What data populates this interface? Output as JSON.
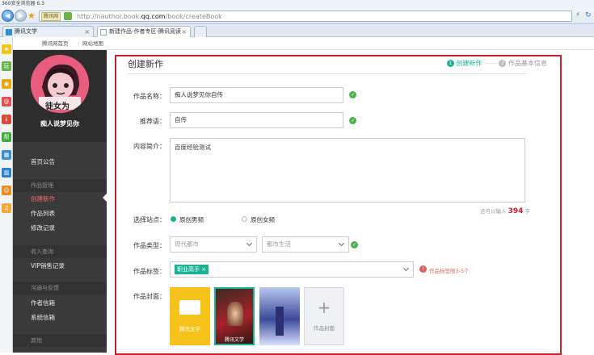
{
  "browser": {
    "title": "360安全浏览器 6.3",
    "url_prefix": "http://nauthor.book.",
    "url_domain": "qq.com",
    "url_path": "/book/createBook",
    "url_tag": "腾讯网",
    "tabs": [
      {
        "label": "腾讯文学"
      },
      {
        "label": "新建作品-作者专区-腾讯阅读"
      }
    ]
  },
  "site_links": [
    "腾讯网首页",
    "网站地图"
  ],
  "sidebar": {
    "username": "痴人说梦见你",
    "avatar_text": "徒女为",
    "nav": [
      {
        "type": "item",
        "label": "首页公告"
      },
      {
        "type": "head",
        "label": "作品管理"
      },
      {
        "type": "item",
        "label": "创建新作",
        "active": true
      },
      {
        "type": "item",
        "label": "作品列表"
      },
      {
        "type": "item",
        "label": "修改记录"
      },
      {
        "type": "head",
        "label": "收入查询"
      },
      {
        "type": "item",
        "label": "VIP销售记录"
      },
      {
        "type": "head",
        "label": "沟通与反馈"
      },
      {
        "type": "item",
        "label": "作者信箱"
      },
      {
        "type": "item",
        "label": "系统信箱"
      },
      {
        "type": "head",
        "label": "其他"
      }
    ]
  },
  "page": {
    "title": "创建新作",
    "step1_num": "1",
    "step1": "创建新作",
    "step2_num": "2",
    "step2": "作品基本信息"
  },
  "form": {
    "name_label": "作品名称：",
    "name_value": "痴人说梦见你自传",
    "slogan_label": "推荐语：",
    "slogan_value": "自传",
    "intro_label": "内容简介：",
    "intro_value": "百度经验测试",
    "intro_count_prefix": "还可以输入",
    "intro_count": "394",
    "intro_count_suffix": "字",
    "site_label": "选择站点：",
    "site_options": [
      "原创男频",
      "原创女频"
    ],
    "type_label": "作品类型：",
    "type_values": [
      "现代都市",
      "都市生活"
    ],
    "tags_label": "作品标签：",
    "tag_chip": "职业高手",
    "tag_hint": "作品标签限3-5个",
    "cover_label": "作品封面：",
    "cover_add_label": "作品封面",
    "cover1_text": "腾讯文学",
    "cover2_text": "腾讯文学"
  },
  "colors": {
    "accent": "#19b394",
    "active_nav": "#f06a6a",
    "highlight": "#c8202c",
    "sidebar_bg": "#3a3a3a"
  }
}
